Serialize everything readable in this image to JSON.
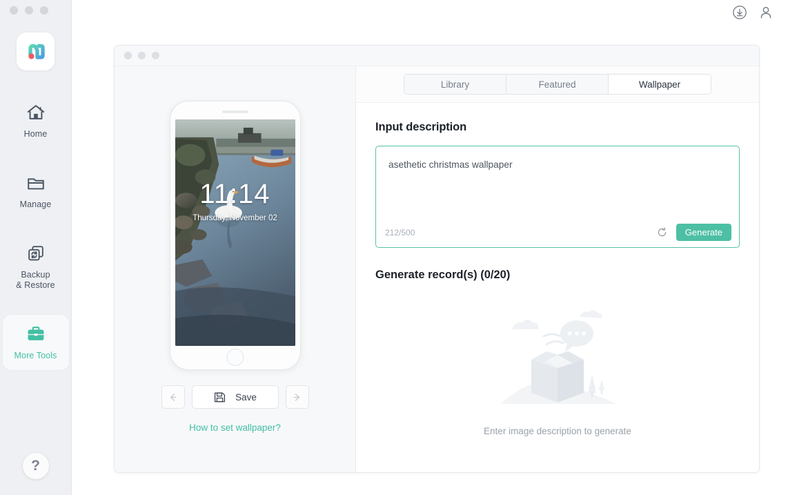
{
  "window": {
    "traffic_lights": [
      "close",
      "minimize",
      "maximize"
    ]
  },
  "topbar": {
    "download_icon": "download-circle-icon",
    "account_icon": "person-icon"
  },
  "sidebar": {
    "logo_icon": "app-logo-m-icon",
    "items": [
      {
        "label": "Home",
        "icon": "home-icon",
        "active": false
      },
      {
        "label": "Manage",
        "icon": "folder-icon",
        "active": false
      },
      {
        "label": "Backup\n& Restore",
        "label_line1": "Backup",
        "label_line2": "& Restore",
        "icon": "backup-restore-icon",
        "active": false
      },
      {
        "label": "More Tools",
        "icon": "briefcase-icon",
        "active": true
      }
    ],
    "help_label": "?"
  },
  "tabs": [
    {
      "label": "Library",
      "active": false
    },
    {
      "label": "Featured",
      "active": false
    },
    {
      "label": "Wallpaper",
      "active": true
    }
  ],
  "preview": {
    "lock_time": "11:14",
    "lock_date": "Thursday, November 02",
    "prev_icon": "arrow-left-icon",
    "next_icon": "arrow-right-icon",
    "save_label": "Save",
    "save_icon": "floppy-disk-icon",
    "howto_label": "How to set wallpaper?"
  },
  "input_section": {
    "title": "Input description",
    "value": "asethetic christmas wallpaper",
    "placeholder": "Enter image description",
    "counter": "212/500",
    "refresh_icon": "refresh-icon",
    "generate_label": "Generate"
  },
  "records_section": {
    "title": "Generate record(s) (0/20)",
    "empty_caption": "Enter image description to generate",
    "empty_illustration": "empty-box-illustration"
  },
  "colors": {
    "accent_teal": "#43bfa3",
    "generate_teal": "#4dbfa4",
    "sidebar_bg": "#eef0f3",
    "text_dark": "#1c2128",
    "text_muted": "#9aa1a9"
  }
}
